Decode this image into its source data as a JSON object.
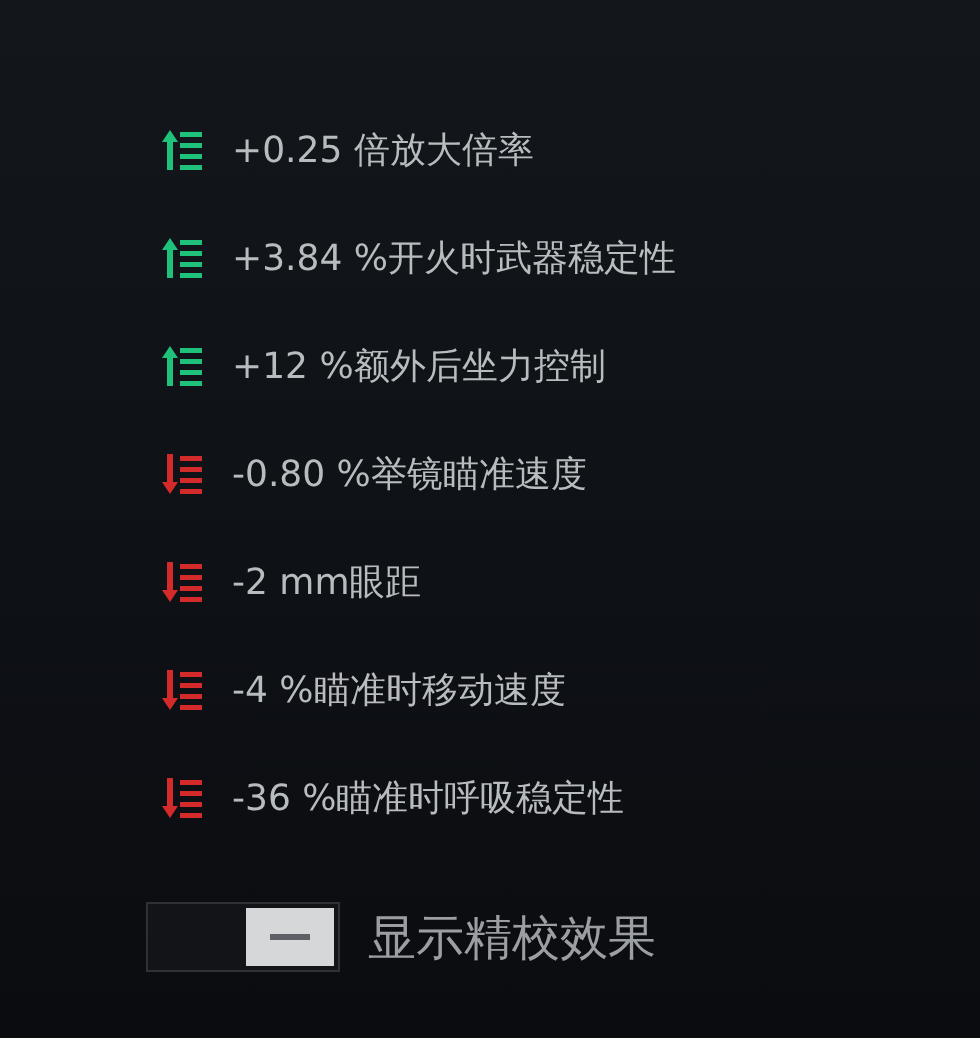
{
  "stats": [
    {
      "kind": "increase",
      "text": "+0.25 倍放大倍率"
    },
    {
      "kind": "increase",
      "text": "+3.84 %开火时武器稳定性"
    },
    {
      "kind": "increase",
      "text": "+12 %额外后坐力控制"
    },
    {
      "kind": "decrease",
      "text": "-0.80 %举镜瞄准速度"
    },
    {
      "kind": "decrease",
      "text": "-2 mm眼距"
    },
    {
      "kind": "decrease",
      "text": "-4 %瞄准时移动速度"
    },
    {
      "kind": "decrease",
      "text": "-36 %瞄准时呼吸稳定性"
    }
  ],
  "toggle": {
    "label": "显示精校效果",
    "on": true
  }
}
